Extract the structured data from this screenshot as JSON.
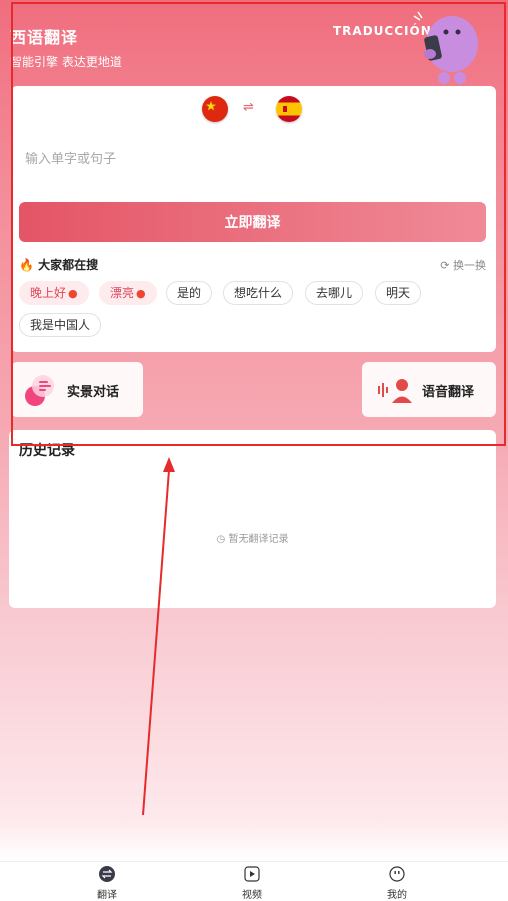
{
  "header": {
    "title": "西语翻译",
    "subtitle": "智能引擎 表达更地道",
    "banner_text": "TRADUCCIÓN!"
  },
  "translator": {
    "source_flag": "china-flag-icon",
    "target_flag": "spain-flag-icon",
    "swap_icon": "⇌",
    "input_placeholder": "输入单字或句子",
    "translate_button": "立即翻译"
  },
  "hot_search": {
    "title": "大家都在搜",
    "refresh_label": "换一换",
    "items": [
      {
        "label": "晚上好",
        "hot": true
      },
      {
        "label": "漂亮",
        "hot": true
      },
      {
        "label": "是的",
        "hot": false
      },
      {
        "label": "想吃什么",
        "hot": false
      },
      {
        "label": "去哪儿",
        "hot": false
      },
      {
        "label": "明天",
        "hot": false
      },
      {
        "label": "我是中国人",
        "hot": false
      }
    ]
  },
  "features": {
    "scene_dialog": "实景对话",
    "voice_translate": "语音翻译"
  },
  "history": {
    "title": "历史记录",
    "empty_text": "暂无翻译记录"
  },
  "nav": {
    "items": [
      {
        "label": "翻译",
        "icon": "translate-icon"
      },
      {
        "label": "视频",
        "icon": "video-icon"
      },
      {
        "label": "我的",
        "icon": "profile-icon"
      }
    ]
  },
  "colors": {
    "accent": "#e45566",
    "highlight": "#e52b2b"
  }
}
